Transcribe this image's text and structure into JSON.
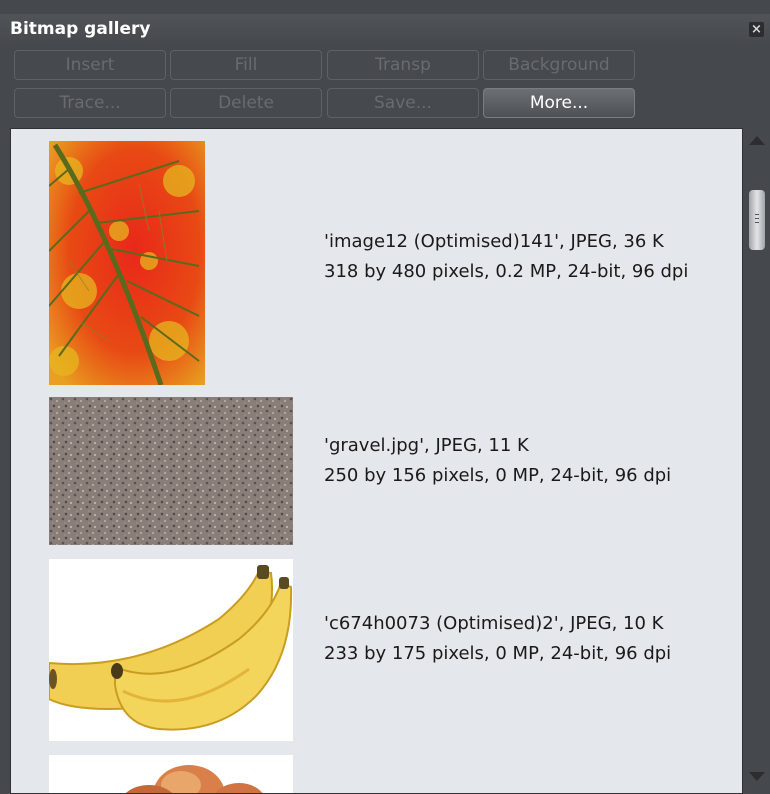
{
  "window": {
    "title": "Bitmap gallery"
  },
  "toolbar": {
    "insert": "Insert",
    "fill": "Fill",
    "transp": "Transp",
    "background": "Background",
    "trace": "Trace...",
    "delete": "Delete",
    "save": "Save...",
    "more": "More..."
  },
  "items": [
    {
      "line1": "'image12 (Optimised)141',  JPEG,  36 K",
      "line2": "318 by 480 pixels, 0.2 MP, 24-bit,  96 dpi"
    },
    {
      "line1": "'gravel.jpg',  JPEG,  11 K",
      "line2": "250 by 156 pixels, 0 MP, 24-bit,  96 dpi"
    },
    {
      "line1": "'c674h0073 (Optimised)2',  JPEG,  10 K",
      "line2": "233 by 175 pixels, 0 MP, 24-bit,  96 dpi"
    }
  ],
  "icons": {
    "close": "close-icon",
    "scroll_up": "scroll-up-arrow-icon",
    "scroll_down": "scroll-down-arrow-icon"
  },
  "colors": {
    "panel": "#45484c",
    "list_bg": "#e4e7ec",
    "title": "#ffffff",
    "disabled_text": "#686b70"
  }
}
